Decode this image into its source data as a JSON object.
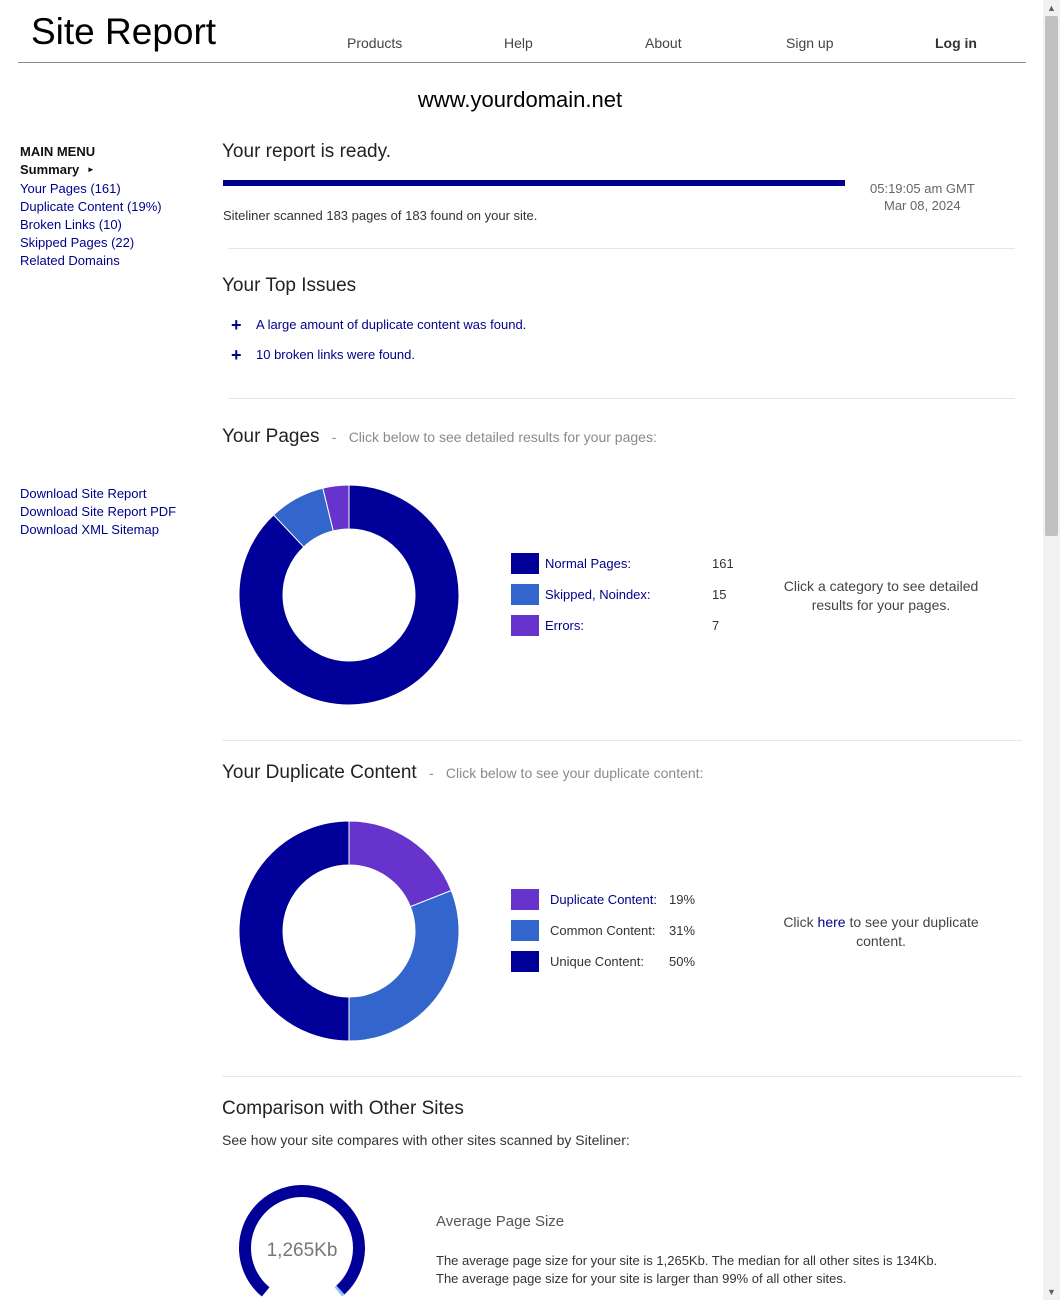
{
  "header": {
    "title": "Site Report",
    "nav": [
      {
        "label": "Products"
      },
      {
        "label": "Help"
      },
      {
        "label": "About"
      },
      {
        "label": "Sign up"
      },
      {
        "label": "Log in"
      }
    ]
  },
  "domain": "www.yourdomain.net",
  "sidebar": {
    "heading": "MAIN MENU",
    "current": "Summary",
    "items": [
      {
        "label": "Your Pages (161)"
      },
      {
        "label": "Duplicate Content (19%)"
      },
      {
        "label": "Broken Links (10)"
      },
      {
        "label": "Skipped Pages (22)"
      },
      {
        "label": "Related Domains"
      }
    ],
    "downloads": [
      {
        "label": "Download Site Report"
      },
      {
        "label": "Download Site Report PDF"
      },
      {
        "label": "Download XML Sitemap"
      }
    ]
  },
  "report": {
    "heading": "Your report is ready.",
    "progress": 1.0,
    "time": "05:19:05 am GMT",
    "date": "Mar 08, 2024",
    "scanned": "Siteliner scanned 183 pages of 183 found on your site."
  },
  "issues": {
    "heading": "Your Top Issues",
    "items": [
      {
        "text": "A large amount of duplicate content was found."
      },
      {
        "text": "10 broken links were found."
      }
    ]
  },
  "pages": {
    "heading": "Your Pages",
    "subheading": "Click below to see detailed results for your pages:",
    "legend": [
      {
        "label": "Normal Pages:",
        "value": "161",
        "color": "#000099"
      },
      {
        "label": "Skipped, Noindex:",
        "value": "15",
        "color": "#3366cc"
      },
      {
        "label": "Errors:",
        "value": "7",
        "color": "#6633cc"
      }
    ],
    "hint": "Click a category to see detailed results for your pages."
  },
  "duplicate": {
    "heading": "Your Duplicate Content",
    "subheading": "Click below to see your duplicate content:",
    "legend": [
      {
        "label": "Duplicate Content:",
        "value": "19%",
        "color": "#6633cc"
      },
      {
        "label": "Common Content:",
        "value": "31%",
        "color": "#3366cc"
      },
      {
        "label": "Unique Content:",
        "value": "50%",
        "color": "#000099"
      }
    ],
    "hint_pre": "Click ",
    "hint_link": "here",
    "hint_post": " to see your duplicate content."
  },
  "comparison": {
    "heading": "Comparison with Other Sites",
    "intro": "See how your site compares with other sites scanned by Siteliner:",
    "gauge_value": "1,265Kb",
    "gauge_fraction": 0.99,
    "metric_title": "Average Page Size",
    "line1": "The average page size for your site is 1,265Kb. The median for all other sites is 134Kb.",
    "line2": "The average page size for your site is larger than 99% of all other sites."
  },
  "chart_data": [
    {
      "type": "pie",
      "categories": [
        "Normal Pages",
        "Skipped, Noindex",
        "Errors"
      ],
      "values": [
        161,
        15,
        7
      ],
      "colors": [
        "#000099",
        "#3366cc",
        "#6633cc"
      ]
    },
    {
      "type": "pie",
      "categories": [
        "Duplicate Content",
        "Common Content",
        "Unique Content"
      ],
      "values": [
        19,
        31,
        50
      ],
      "colors": [
        "#6633cc",
        "#3366cc",
        "#000099"
      ]
    }
  ]
}
